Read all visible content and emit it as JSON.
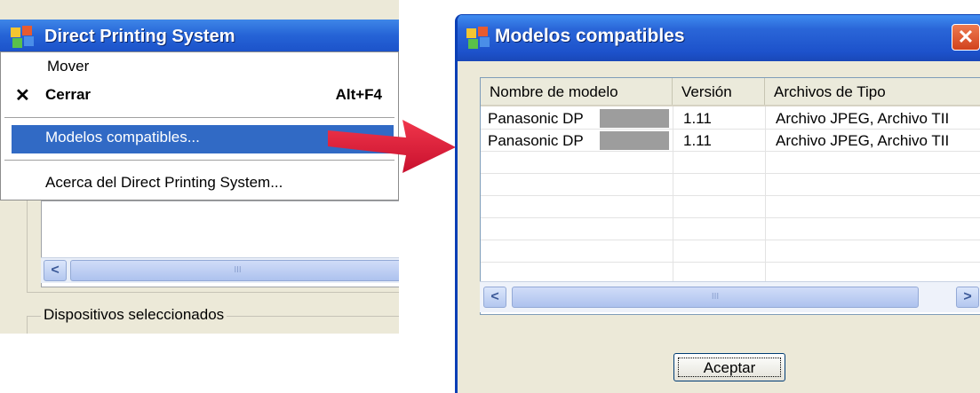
{
  "left_window": {
    "title": "Direct Printing System",
    "menu": {
      "move": "Mover",
      "close_mark": "✕",
      "close": "Cerrar",
      "close_shortcut": "Alt+F4",
      "supported_models": "Modelos compatibles...",
      "about": "Acerca del Direct Printing System..."
    },
    "group_label": "Dispositivos seleccionados",
    "scroll": {
      "left_arrow": "<",
      "thumb_grip": "III"
    }
  },
  "dialog": {
    "title": "Modelos compatibles",
    "close_glyph": "✕",
    "columns": [
      "Nombre de modelo",
      "Versión",
      "Archivos de Tipo"
    ],
    "rows": [
      {
        "model": "Panasonic DP",
        "version": "1.11",
        "types": "Archivo JPEG, Archivo TII"
      },
      {
        "model": "Panasonic DP",
        "version": "1.11",
        "types": "Archivo JPEG, Archivo TII"
      }
    ],
    "scroll": {
      "left_arrow": "<",
      "right_arrow": ">",
      "thumb_grip": "III"
    },
    "ok_label": "Aceptar"
  },
  "colors": {
    "titlebar": "#2563d6",
    "menu_highlight": "#316ac5",
    "arrow": "#e3243a",
    "close_button": "#d1421c",
    "redaction": "#9d9d9d"
  },
  "icons": [
    "app-icon",
    "close-icon",
    "arrow-icon",
    "scroll-left-icon",
    "scroll-right-icon"
  ]
}
